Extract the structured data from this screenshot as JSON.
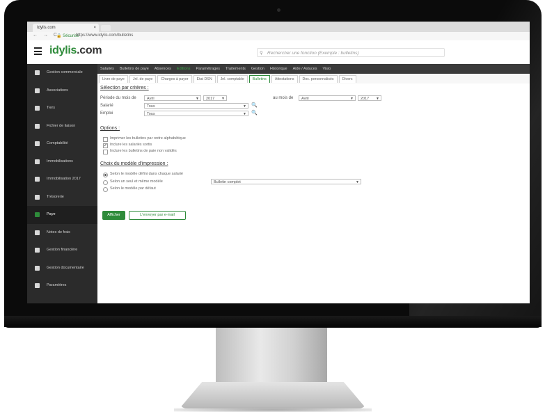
{
  "browser": {
    "tab_title": "Idylis.com",
    "tab_close": "×",
    "nav_glyphs": "← → C",
    "secure_label": "🔒 Sécurisé",
    "url": "https://www.idylis.com/bulletins"
  },
  "header": {
    "logo": "idylis",
    "logo_suffix": ".com",
    "search_placeholder": "Rechercher une fonction (Exemple : bulletins)"
  },
  "sidebar": {
    "items": [
      {
        "label": "Gestion commerciale",
        "icon": "cart-icon"
      },
      {
        "label": "Associations",
        "icon": "people-icon"
      },
      {
        "label": "Tiers",
        "icon": "users-icon"
      },
      {
        "label": "Fichier de liaison",
        "icon": "file-icon"
      },
      {
        "label": "Comptabilité",
        "icon": "ledger-icon"
      },
      {
        "label": "Immobilisations",
        "icon": "building-icon"
      },
      {
        "label": "Immobilisation 2017",
        "icon": "calendar-icon"
      },
      {
        "label": "Trésorerie",
        "icon": "bank-icon"
      },
      {
        "label": "Paye",
        "icon": "payslip-icon"
      },
      {
        "label": "Notes de frais",
        "icon": "receipt-icon"
      },
      {
        "label": "Gestion financière",
        "icon": "finance-icon"
      },
      {
        "label": "Gestion documentaire",
        "icon": "folder-icon"
      },
      {
        "label": "Paramètres",
        "icon": "gear-icon"
      }
    ],
    "active_index": 8
  },
  "menubar": {
    "items": [
      "Salariés",
      "Bulletins de paye",
      "Absences",
      "Editions",
      "Paramétrages",
      "Traitements",
      "Gestion",
      "Historique",
      "Aide / Astuces",
      "Visio"
    ],
    "active_index": 3
  },
  "subtabs": {
    "items": [
      "Livre de paye",
      "Jnl. de paye",
      "Charges à payer",
      "Etat DSN",
      "Jnl. comptable",
      "Bulletins",
      "Attestations",
      "Doc. personnalisés",
      "Divers"
    ],
    "active_index": 5
  },
  "form": {
    "selection_title": "Sélection par critères :",
    "period_label": "Période du mois de",
    "period_month": "Avril",
    "period_year": "2017",
    "period_to_label": "au mois de",
    "period_to_month": "Avril",
    "period_to_year": "2017",
    "salarie_label": "Salarié",
    "salarie_value": "Tous",
    "emploi_label": "Emploi",
    "emploi_value": "Tous",
    "options_title": "Options :",
    "options": [
      {
        "label": "Imprimer les bulletins par ordre alphabétique",
        "checked": false
      },
      {
        "label": "Inclure les salariés sortis",
        "checked": true
      },
      {
        "label": "Inclure les bulletins de paie non validés",
        "checked": false
      }
    ],
    "model_title": "Choix du modèle d'impression :",
    "model_options": [
      {
        "label": "Selon le modèle défini dans chaque salarié",
        "checked": true
      },
      {
        "label": "Selon un seul et même modèle",
        "checked": false
      },
      {
        "label": "Selon le modèle par défaut",
        "checked": false
      }
    ],
    "model_select": "Bulletin complet",
    "print_button": "Afficher",
    "email_button": "L'envoyer par e-mail"
  }
}
